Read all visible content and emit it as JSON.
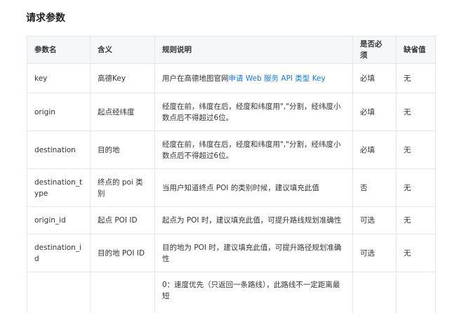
{
  "section_title": "请求参数",
  "headers": [
    "参数名",
    "含义",
    "规则说明",
    "是否必须",
    "缺省值"
  ],
  "rows": [
    {
      "name": "key",
      "meaning": "高德Key",
      "rule_prefix": "用户在高德地图官网",
      "rule_link": "申请 Web 服务 API 类型 Key",
      "required": "必填",
      "default": "无"
    },
    {
      "name": "origin",
      "meaning": "起点经纬度",
      "rule": "经度在前，纬度在后，经度和纬度用\",\"分割，经纬度小数点后不得超过6位。",
      "required": "必填",
      "default": "无"
    },
    {
      "name": "destination",
      "meaning": "目的地",
      "rule": "经度在前，纬度在后，经度和纬度用\",\"分割，经纬度小数点后不得超过6位。",
      "required": "必填",
      "default": "无"
    },
    {
      "name": "destination_type",
      "meaning": "终点的 poi 类别",
      "rule": "当用户知道终点 POI 的类别时候，建议填充此值",
      "required": "否",
      "default": "无"
    },
    {
      "name": "origin_id",
      "meaning": "起点 POI ID",
      "rule": "起点为 POI 时，建议填充此值，可提升路线规划准确性",
      "required": "可选",
      "default": "无"
    },
    {
      "name": "destination_id",
      "meaning": "目的地 POI ID",
      "rule": "目的地为 POI 时，建议填充此值，可提升路径规划准确性",
      "required": "可选",
      "default": "无"
    },
    {
      "name": "",
      "meaning": "",
      "rule": "0：速度优先（只返回一条路线），此路线不一定距离最短",
      "required": "",
      "default": ""
    }
  ]
}
